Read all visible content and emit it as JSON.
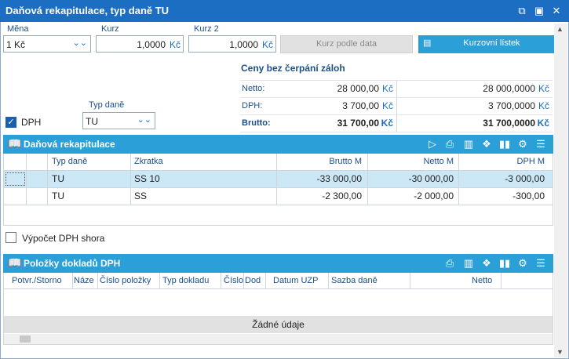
{
  "window": {
    "title": "Daňová rekapitulace, typ daně TU"
  },
  "header": {
    "mena_label": "Měna",
    "mena_value": "1 Kč",
    "kurz_label": "Kurz",
    "kurz_value": "1,0000",
    "kurz_ccy": "Kč",
    "kurz2_label": "Kurz 2",
    "kurz2_value": "1,0000",
    "kurz2_ccy": "Kč",
    "kurz_podle_data": "Kurz podle data",
    "kurzovni_listek": "Kurzovní lístek"
  },
  "summary": {
    "title": "Ceny bez čerpání záloh",
    "rows": [
      {
        "label": "Netto:",
        "v1": "28 000,00",
        "c1": "Kč",
        "v2": "28 000,0000",
        "c2": "Kč"
      },
      {
        "label": "DPH:",
        "v1": "3 700,00",
        "c1": "Kč",
        "v2": "3 700,0000",
        "c2": "Kč"
      },
      {
        "label": "Brutto:",
        "v1": "31 700,00",
        "c1": "Kč",
        "v2": "31 700,0000",
        "c2": "Kč"
      }
    ]
  },
  "dph": {
    "label": "DPH",
    "checked": true
  },
  "typ_dane": {
    "label": "Typ daně",
    "value": "TU"
  },
  "rekap": {
    "title": "Daňová rekapitulace",
    "columns": [
      "Typ daně",
      "Zkratka",
      "Brutto M",
      "Netto M",
      "DPH M"
    ],
    "rows": [
      {
        "typ": "TU",
        "zkratka": "SS 10",
        "brutto": "-33 000,00",
        "netto": "-30 000,00",
        "dph": "-3 000,00"
      },
      {
        "typ": "TU",
        "zkratka": "SS",
        "brutto": "-2 300,00",
        "netto": "-2 000,00",
        "dph": "-300,00"
      }
    ]
  },
  "vypocet": {
    "label": "Výpočet DPH shora",
    "checked": false
  },
  "polozky": {
    "title": "Položky dokladů DPH",
    "columns": [
      "Potvr./Storno",
      "Náze",
      "Číslo položky",
      "Typ dokladu",
      "Číslo",
      "Dod",
      "Datum UZP",
      "Sazba daně",
      "Netto"
    ],
    "empty": "Žádné údaje"
  },
  "colors": {
    "titlebar": "#1b6ec2",
    "section": "#2a9fd8",
    "selected_row": "#cce8f7"
  }
}
